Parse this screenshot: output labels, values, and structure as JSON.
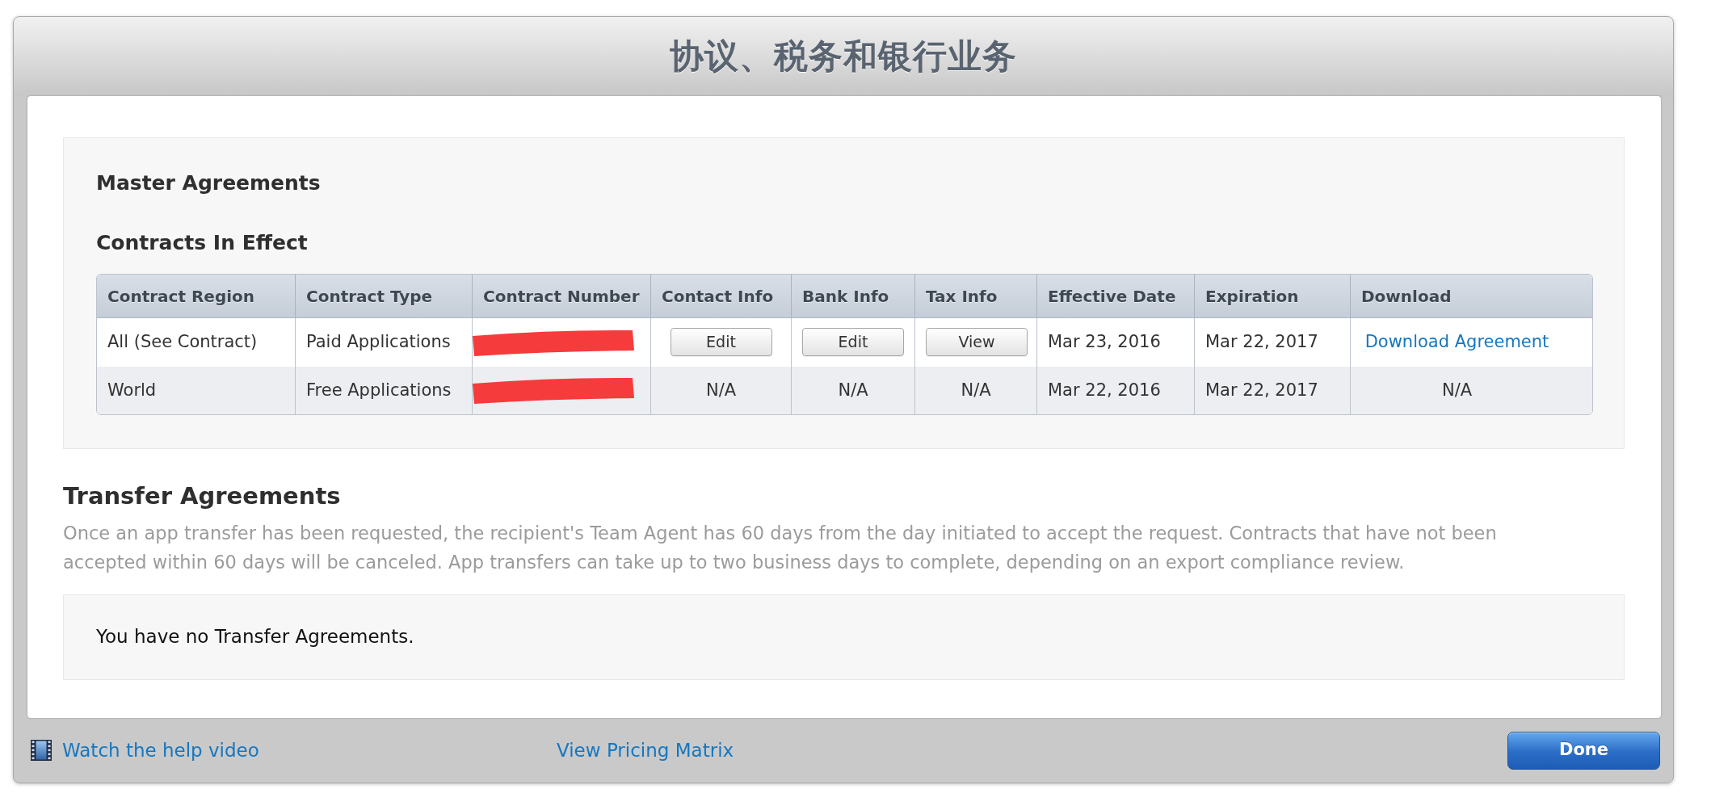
{
  "window": {
    "title": "协议、税务和银行业务"
  },
  "master_agreements": {
    "heading": "Master Agreements",
    "subheading": "Contracts In Effect",
    "table": {
      "columns": [
        "Contract Region",
        "Contract Type",
        "Contract Number",
        "Contact Info",
        "Bank Info",
        "Tax Info",
        "Effective Date",
        "Expiration",
        "Download"
      ],
      "rows": [
        {
          "cells": [
            {
              "kind": "text",
              "text": "All (See Contract)"
            },
            {
              "kind": "text",
              "text": "Paid Applications"
            },
            {
              "kind": "redacted"
            },
            {
              "kind": "button",
              "text": "Edit"
            },
            {
              "kind": "button",
              "text": "Edit"
            },
            {
              "kind": "button",
              "text": "View"
            },
            {
              "kind": "text",
              "text": "Mar 23, 2016"
            },
            {
              "kind": "text",
              "text": "Mar 22, 2017"
            },
            {
              "kind": "link",
              "text": "Download Agreement"
            }
          ]
        },
        {
          "cells": [
            {
              "kind": "text",
              "text": "World"
            },
            {
              "kind": "text",
              "text": "Free Applications"
            },
            {
              "kind": "redacted"
            },
            {
              "kind": "na",
              "text": "N/A"
            },
            {
              "kind": "na",
              "text": "N/A"
            },
            {
              "kind": "na",
              "text": "N/A"
            },
            {
              "kind": "text",
              "text": "Mar 22, 2016"
            },
            {
              "kind": "text",
              "text": "Mar 22, 2017"
            },
            {
              "kind": "na",
              "text": "N/A"
            }
          ]
        }
      ]
    }
  },
  "transfer_agreements": {
    "heading": "Transfer Agreements",
    "description": "Once an app transfer has been requested, the recipient's Team Agent has 60 days from the day initiated to accept the request. Contracts that have not been accepted within 60 days will be canceled. App transfers can take up to two business days to complete, depending on an export compliance review.",
    "empty_message": "You have no Transfer Agreements."
  },
  "footer": {
    "links": [
      {
        "kind": "video",
        "text": "Watch the help video"
      },
      {
        "kind": "plain",
        "text": "View Pricing Matrix"
      }
    ],
    "done_button": "Done"
  }
}
